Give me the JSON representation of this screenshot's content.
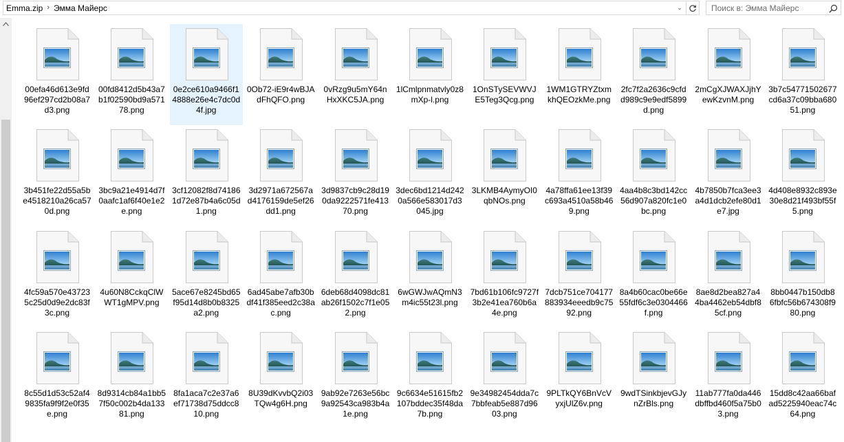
{
  "address_bar": {
    "breadcrumbs": [
      "Emma.zip",
      "Эмма Майерс"
    ]
  },
  "search": {
    "placeholder": "Поиск в: Эмма Майерс"
  },
  "files": [
    "00efa46d613e9fd96ef297cd2b08a7d3.png",
    "00fd8412d5b43a7b1f02590bd9a57178.png",
    "0e2ce610a9466f14888e26e4c7dc0d4f.jpg",
    "0Ob72-iE9r4wBJAdFhQFO.png",
    "0vRzg9u5mY64nHxXKC5JA.png",
    "1lCmlpnmatvly0z8mXp-l.png",
    "1OnSTySEVWVJE5Teg3Qcg.png",
    "1WM1GTRYZtxmkhQEOzkMe.png",
    "2fc7f2a2636c9cfdd989c9e9edf5899d.png",
    "2mCgXJWAXJjhYewKzvnM.png",
    "3b7c54771502677cd6a37c09bba68051.png",
    "3b451fe22d55a5be4518210a26ca570d.png",
    "3bc9a21e4914d7f0aafc1af6f40e1e2e.png",
    "3cf12082f8d741861d72e87b4a6c05d1.png",
    "3d2971a672567ad4176159de5ef26dd1.png",
    "3d9837cb9c28d190da9222571fe41370.png",
    "3dec6bd1214d2420a566e583017d3045.jpg",
    "3LKMB4AymyOI0qbNOs.png",
    "4a78ffa61ee13f39c693a4510a58b469.png",
    "4aa4b8c3bd142cc56d907a820fc1e0bc.png",
    "4b7850b7fca3ee3a4d1dcb2efe80d1e7.jpg",
    "4d408e8932c893e30e8d21f493bf55f5.png",
    "4fc59a570e437235c25d0d9e2dc83f3c.png",
    "4u60N8CckqClWWT1gMPV.png",
    "5ace67e8245bd65f95d14d8b0b8325a2.png",
    "6ad45abe7afb30bdf41f385eed2c38ac.png",
    "6deb68d4098dc81ab26f1502c7f1e052.png",
    "6wGWJwAQmN3m4ic55t23l.png",
    "7bd61b106fc9727f3b2e41ea760b6a4e.png",
    "7dcb751ce704177883934eeedb9c7592.png",
    "8a4b60cac0be66e55fdf6c3e0304466f.png",
    "8ae8d2bea827a44ba4462eb54dbf85cf.png",
    "8bb0447b150db86fbfc56b674308f980.png",
    "8c55d1d53c52af49835fa9f9f2e0f35e.png",
    "8d9314cb84a1bb57f50c002b4da13381.png",
    "8fa1aca7c2e37a6ef71738d75ddcc810.png",
    "8U39dKvvbQ2i03TQw4g6H.png",
    "9ab92e7263e56bc9a92543ca983b4a1e.png",
    "9c6634e51615fb2107bddec35f48da7b.png",
    "9e34982454dda7c7bbfeab5e887d9603.png",
    "9PLTkQY6BnVcVyxjUlZ6v.png",
    "9wdTSinkbjevGJynZrBls.png",
    "11ab777fa0da446dbffbd460f5a75b03.png",
    "15dd8c42aa66baf ad5225940eac74c64.png"
  ],
  "selected_index": 2,
  "colors": {
    "selection": "#e5f3ff",
    "scroll_thumb": "#cdcdcd",
    "scroll_track": "#f0f0f0",
    "border": "#d9d9d9"
  }
}
